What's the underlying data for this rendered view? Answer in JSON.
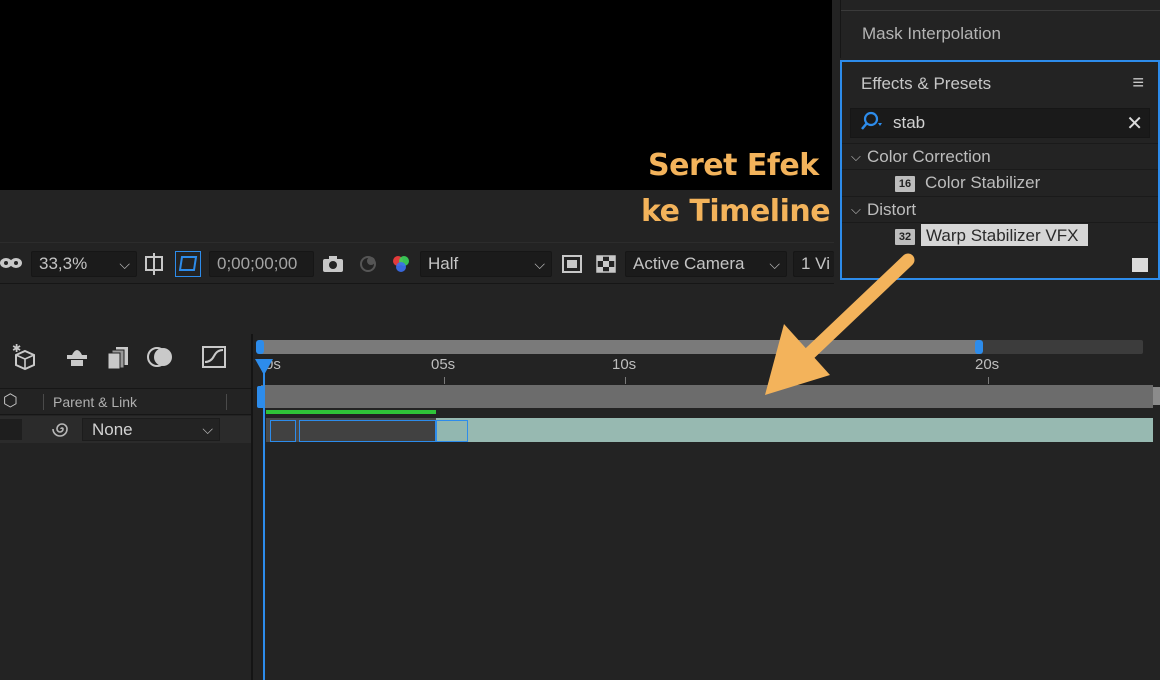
{
  "annotation": {
    "line1": "Seret Efek",
    "line2": "ke Timeline",
    "color": "#f3b35b"
  },
  "viewer_toolbar": {
    "zoom": "33,3%",
    "timecode": "0;00;00;00",
    "resolution": "Half",
    "camera": "Active Camera",
    "views": "1 Vi",
    "icons": [
      "mask-icon",
      "fit-icon",
      "region-icon",
      "snapshot-icon",
      "show-snapshot-icon",
      "channel-icon",
      "transparency-grid-icon",
      "toggle-mask-icon"
    ]
  },
  "mask_panel": {
    "label": "Mask Interpolation"
  },
  "effects_presets": {
    "title": "Effects & Presets",
    "search_value": "stab",
    "search_placeholder": "",
    "categories": [
      {
        "name": "Color Correction",
        "items": [
          {
            "badge": "16",
            "label": "Color Stabilizer",
            "selected": false
          }
        ]
      },
      {
        "name": "Distort",
        "items": [
          {
            "badge": "32",
            "label": "Warp Stabilizer VFX",
            "selected": true
          }
        ]
      }
    ],
    "accent": "#2d8ceb"
  },
  "timeline": {
    "column_header": "Parent & Link",
    "layer_parent": "None",
    "ruler": [
      "0s",
      "05s",
      "10s",
      "20s"
    ],
    "playhead_label": "00s",
    "icons": [
      "draft-3d-icon",
      "shy-layers-icon",
      "frame-blending-icon",
      "motion-blur-icon",
      "graph-editor-icon"
    ],
    "colors": {
      "playhead": "#2d8ceb",
      "layer_bar": "#97b9b1",
      "render_bar": "#2fc438"
    }
  }
}
